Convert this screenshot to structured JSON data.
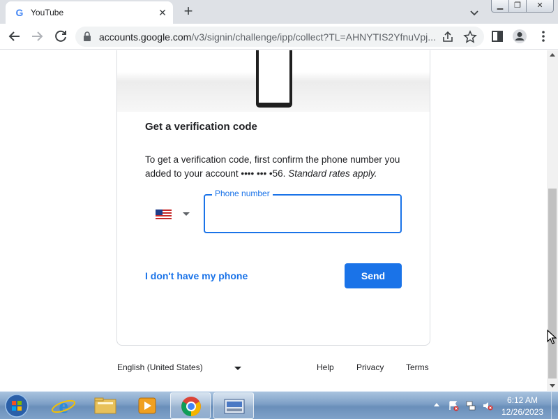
{
  "browser": {
    "tab": {
      "favicon": "G",
      "title": "YouTube",
      "close_icon": "close-icon"
    },
    "url": {
      "host": "accounts.google.com",
      "path": "/v3/signin/challenge/ipp/collect?TL=AHNYTIS2YfnuVpj..."
    },
    "icons": [
      "back-icon",
      "forward-icon",
      "reload-icon",
      "lock-icon",
      "share-icon",
      "star-icon",
      "sidepanel-icon",
      "profile-icon",
      "menu-icon"
    ]
  },
  "card": {
    "heading": "Get a verification code",
    "desc_main": "To get a verification code, first confirm the phone number you added to your account •••• ••• •56.",
    "desc_italic": "Standard rates apply.",
    "country_flag": "us-flag-icon",
    "phone_label": "Phone number",
    "phone_value": "",
    "no_phone_link": "I don't have my phone",
    "send_button": "Send"
  },
  "footer": {
    "language": "English (United States)",
    "help": "Help",
    "privacy": "Privacy",
    "terms": "Terms"
  },
  "taskbar": {
    "time": "6:12 AM",
    "date": "12/26/2023",
    "items": [
      "internet-explorer-icon",
      "file-explorer-icon",
      "media-player-icon",
      "chrome-icon",
      "keyboard-icon"
    ]
  },
  "colors": {
    "accent": "#1a73e8",
    "text": "#202124"
  }
}
